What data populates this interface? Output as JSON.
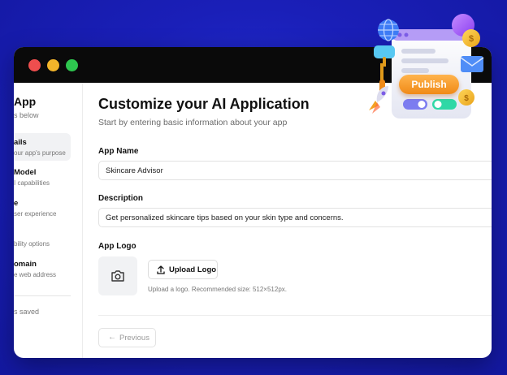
{
  "window": {
    "traffic_lights": [
      "#ee4e4e",
      "#f3b52a",
      "#2ec64f"
    ]
  },
  "sidebar": {
    "title": "App",
    "subtitle": "s below",
    "items": [
      {
        "title": "ails",
        "subtitle": "our app's purpose",
        "active": true
      },
      {
        "title": "Model",
        "subtitle": "I capabilities",
        "active": false
      },
      {
        "title": "e",
        "subtitle": "ser experience",
        "active": false
      },
      {
        "title": "",
        "subtitle": "bility options",
        "active": false
      },
      {
        "title": "omain",
        "subtitle": "e web address",
        "active": false
      }
    ],
    "saved_text": "s saved"
  },
  "main": {
    "title": "Customize your AI Application",
    "subtitle": "Start by entering basic information about your app",
    "app_name": {
      "label": "App Name",
      "value": "Skincare Advisor"
    },
    "description": {
      "label": "Description",
      "value": "Get personalized skincare tips based on your skin type and concerns."
    },
    "app_logo": {
      "label": "App Logo",
      "upload_label": "Upload Logo",
      "hint": "Upload a logo. Recommended size: 512×512px."
    },
    "previous_label": "Previous"
  },
  "illustration": {
    "publish_label": "Publish",
    "icons": [
      "globe-icon",
      "paint-roller-icon",
      "rocket-icon",
      "coin-icon",
      "envelope-icon",
      "toggle-icon"
    ]
  }
}
